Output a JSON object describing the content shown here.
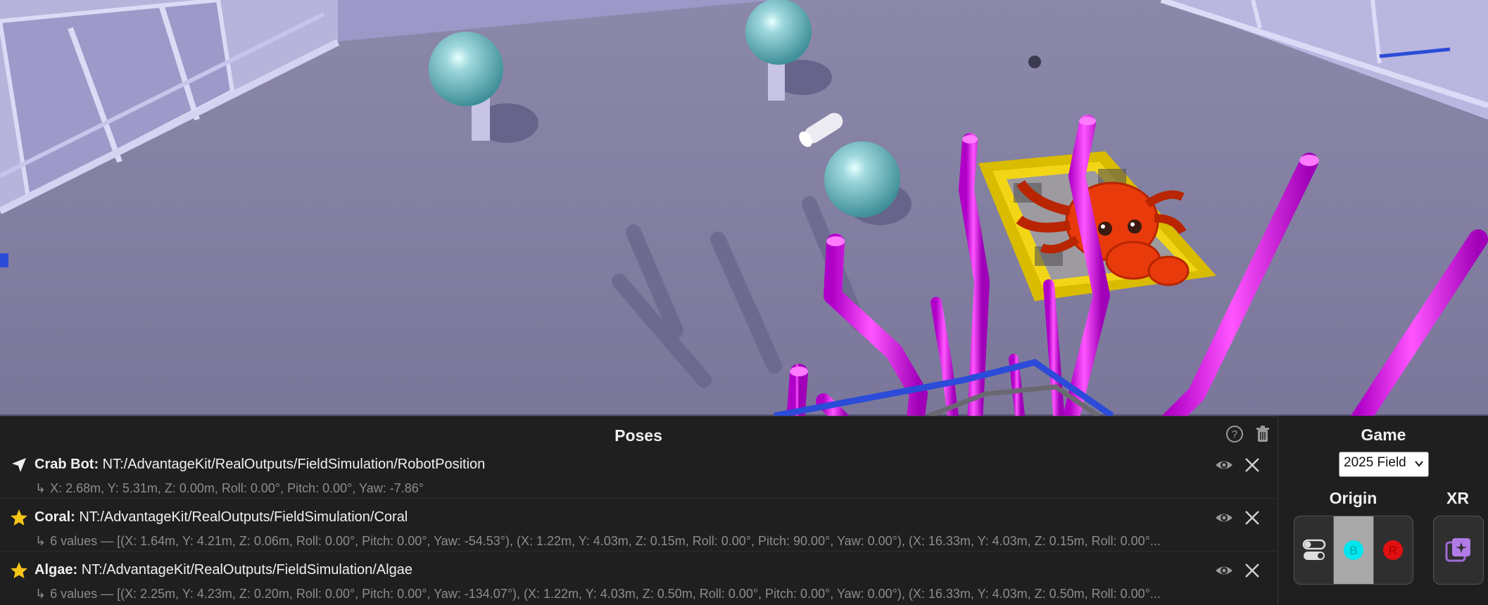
{
  "poses": {
    "title": "Poses",
    "rows": [
      {
        "icon": "navigation-arrow-icon",
        "name": "Crab Bot:",
        "path": "NT:/AdvantageKit/RealOutputs/FieldSimulation/RobotPosition",
        "detail": "X: 2.68m, Y: 5.31m, Z: 0.00m, Roll: 0.00°, Pitch: 0.00°, Yaw: -7.86°"
      },
      {
        "icon": "star-icon",
        "name": "Coral:",
        "path": "NT:/AdvantageKit/RealOutputs/FieldSimulation/Coral",
        "detail": "6 values — [(X: 1.64m, Y: 4.21m, Z: 0.06m, Roll: 0.00°, Pitch: 0.00°, Yaw: -54.53°), (X: 1.22m, Y: 4.03m, Z: 0.15m, Roll: 0.00°, Pitch: 90.00°, Yaw: 0.00°), (X: 16.33m, Y: 4.03m, Z: 0.15m, Roll: 0.00°..."
      },
      {
        "icon": "star-icon",
        "name": "Algae:",
        "path": "NT:/AdvantageKit/RealOutputs/FieldSimulation/Algae",
        "detail": "6 values — [(X: 2.25m, Y: 4.23m, Z: 0.20m, Roll: 0.00°, Pitch: 0.00°, Yaw: -134.07°), (X: 1.22m, Y: 4.03m, Z: 0.50m, Roll: 0.00°, Pitch: 0.00°, Yaw: 0.00°), (X: 16.33m, Y: 4.03m, Z: 0.50m, Roll: 0.00°..."
      }
    ]
  },
  "side": {
    "game_label": "Game",
    "game_value": "2025 Field",
    "origin_label": "Origin",
    "xr_label": "XR",
    "origin_options": [
      "toggle",
      "B",
      "R"
    ],
    "origin_selected": "B",
    "colors": {
      "blue": "#00e5ee",
      "red": "#e01010"
    }
  }
}
